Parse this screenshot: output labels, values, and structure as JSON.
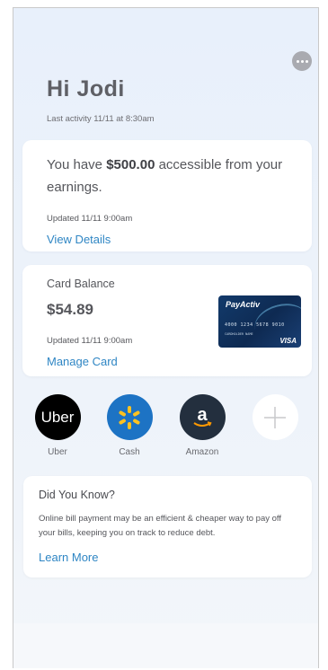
{
  "header": {
    "greeting": "Hi Jodi",
    "last_activity": "Last activity 11/11 at 8:30am"
  },
  "accessible_card": {
    "text_prefix": "You have ",
    "amount": "$500.00",
    "text_suffix": " accessible from your earnings.",
    "updated": "Updated 11/11 9:00am",
    "link": "View Details"
  },
  "balance_card": {
    "label": "Card Balance",
    "value": "$54.89",
    "updated": "Updated 11/11 9:00am",
    "link": "Manage Card",
    "debit_card": {
      "brand": "PayActiv",
      "number": "4000 1234 5678 9010",
      "name": "CARDHOLDER NAME",
      "network": "VISA"
    }
  },
  "shortcuts": [
    {
      "label": "Uber",
      "icon_text": "Uber",
      "icon": "uber-logo-icon"
    },
    {
      "label": "Cash",
      "icon": "walmart-spark-icon"
    },
    {
      "label": "Amazon",
      "icon_text": "a",
      "icon": "amazon-logo-icon"
    },
    {
      "label": "",
      "icon": "plus-icon"
    }
  ],
  "tip_card": {
    "title": "Did You Know?",
    "body": "Online bill payment may be an efficient & cheaper way to pay off your bills, keeping you on track to reduce debt.",
    "link": "Learn More"
  },
  "colors": {
    "accent_link": "#2f86c4",
    "background": "#e8f0fb",
    "card": "#ffffff"
  }
}
